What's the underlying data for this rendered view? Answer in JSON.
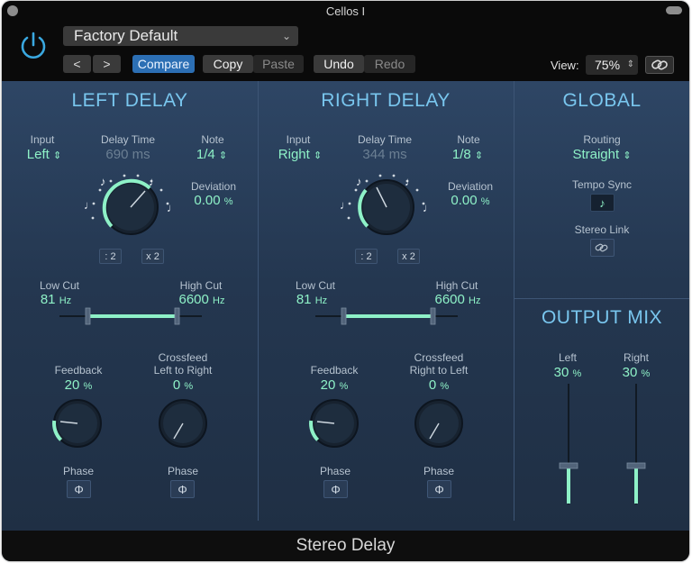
{
  "window": {
    "title": "Cellos I"
  },
  "header": {
    "preset": "Factory Default",
    "prev_label": "<",
    "next_label": ">",
    "compare_label": "Compare",
    "copy_label": "Copy",
    "paste_label": "Paste",
    "undo_label": "Undo",
    "redo_label": "Redo",
    "view_label": "View:",
    "view_value": "75%"
  },
  "left": {
    "title": "LEFT DELAY",
    "input_label": "Input",
    "input_value": "Left",
    "delay_label": "Delay Time",
    "delay_value": "690 ms",
    "note_label": "Note",
    "note_value": "1/4",
    "deviation_label": "Deviation",
    "deviation_value": "0.00",
    "deviation_unit": "%",
    "half_label": ": 2",
    "double_label": "x 2",
    "lowcut_label": "Low Cut",
    "lowcut_value": "81",
    "lowcut_unit": "Hz",
    "highcut_label": "High Cut",
    "highcut_value": "6600",
    "highcut_unit": "Hz",
    "feedback_label": "Feedback",
    "feedback_value": "20",
    "feedback_unit": "%",
    "crossfeed_label": "Crossfeed",
    "crossfeed_sub": "Left to Right",
    "crossfeed_value": "0",
    "crossfeed_unit": "%",
    "phase_label_1": "Phase",
    "phase_label_2": "Phase"
  },
  "right": {
    "title": "RIGHT DELAY",
    "input_label": "Input",
    "input_value": "Right",
    "delay_label": "Delay Time",
    "delay_value": "344 ms",
    "note_label": "Note",
    "note_value": "1/8",
    "deviation_label": "Deviation",
    "deviation_value": "0.00",
    "deviation_unit": "%",
    "half_label": ": 2",
    "double_label": "x 2",
    "lowcut_label": "Low Cut",
    "lowcut_value": "81",
    "lowcut_unit": "Hz",
    "highcut_label": "High Cut",
    "highcut_value": "6600",
    "highcut_unit": "Hz",
    "feedback_label": "Feedback",
    "feedback_value": "20",
    "feedback_unit": "%",
    "crossfeed_label": "Crossfeed",
    "crossfeed_sub": "Right to Left",
    "crossfeed_value": "0",
    "crossfeed_unit": "%",
    "phase_label_1": "Phase",
    "phase_label_2": "Phase"
  },
  "global": {
    "title": "GLOBAL",
    "routing_label": "Routing",
    "routing_value": "Straight",
    "tempo_sync_label": "Tempo Sync",
    "stereo_link_label": "Stereo Link"
  },
  "output": {
    "title": "OUTPUT MIX",
    "left_label": "Left",
    "left_value": "30",
    "left_unit": "%",
    "right_label": "Right",
    "right_value": "30",
    "right_unit": "%"
  },
  "footer": {
    "plugin_name": "Stereo Delay"
  },
  "colors": {
    "accent": "#8ef1c7",
    "title": "#79c6ee",
    "power": "#3aa8e0",
    "compare": "#2c6fb4"
  },
  "icons": [
    "power-icon",
    "chevron-left-icon",
    "chevron-right-icon",
    "link-icon",
    "note-icon",
    "phase-icon"
  ]
}
